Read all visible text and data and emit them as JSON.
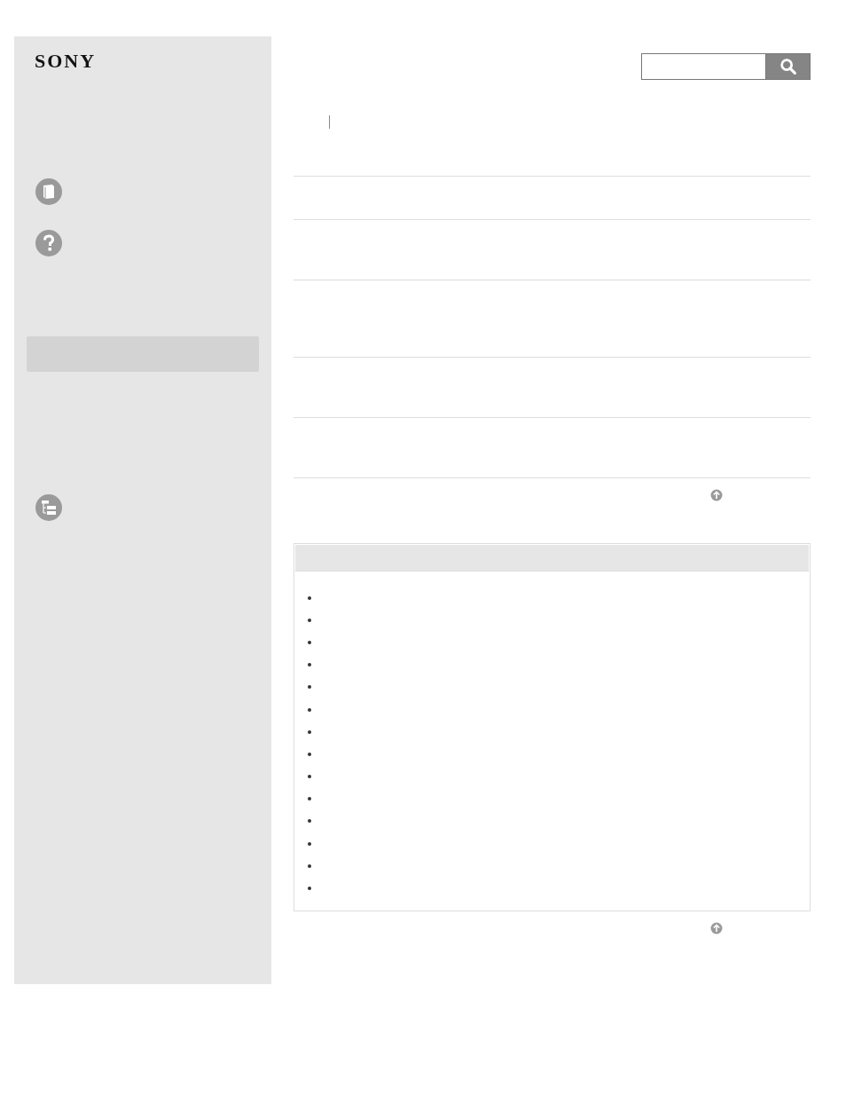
{
  "sidebar": {
    "logo": "SONY",
    "items": [
      {
        "kind": "book"
      },
      {
        "kind": "help"
      },
      {
        "kind": "highlight",
        "selected": true
      },
      {
        "kind": "tree"
      }
    ]
  },
  "rows": [
    {
      "kind": "short"
    },
    {
      "kind": "medium"
    },
    {
      "kind": "tall"
    },
    {
      "kind": "medium"
    },
    {
      "kind": "medium"
    }
  ],
  "related_panel": {
    "items": [
      {
        "kind": "bullet"
      },
      {
        "kind": "bullet"
      },
      {
        "kind": "bullet"
      },
      {
        "kind": "bullet"
      },
      {
        "kind": "bullet"
      },
      {
        "kind": "bullet"
      },
      {
        "kind": "bullet"
      },
      {
        "kind": "bullet"
      },
      {
        "kind": "bullet"
      },
      {
        "kind": "bullet"
      },
      {
        "kind": "bullet"
      },
      {
        "kind": "bullet"
      },
      {
        "kind": "bullet"
      },
      {
        "kind": "bullet"
      }
    ]
  }
}
